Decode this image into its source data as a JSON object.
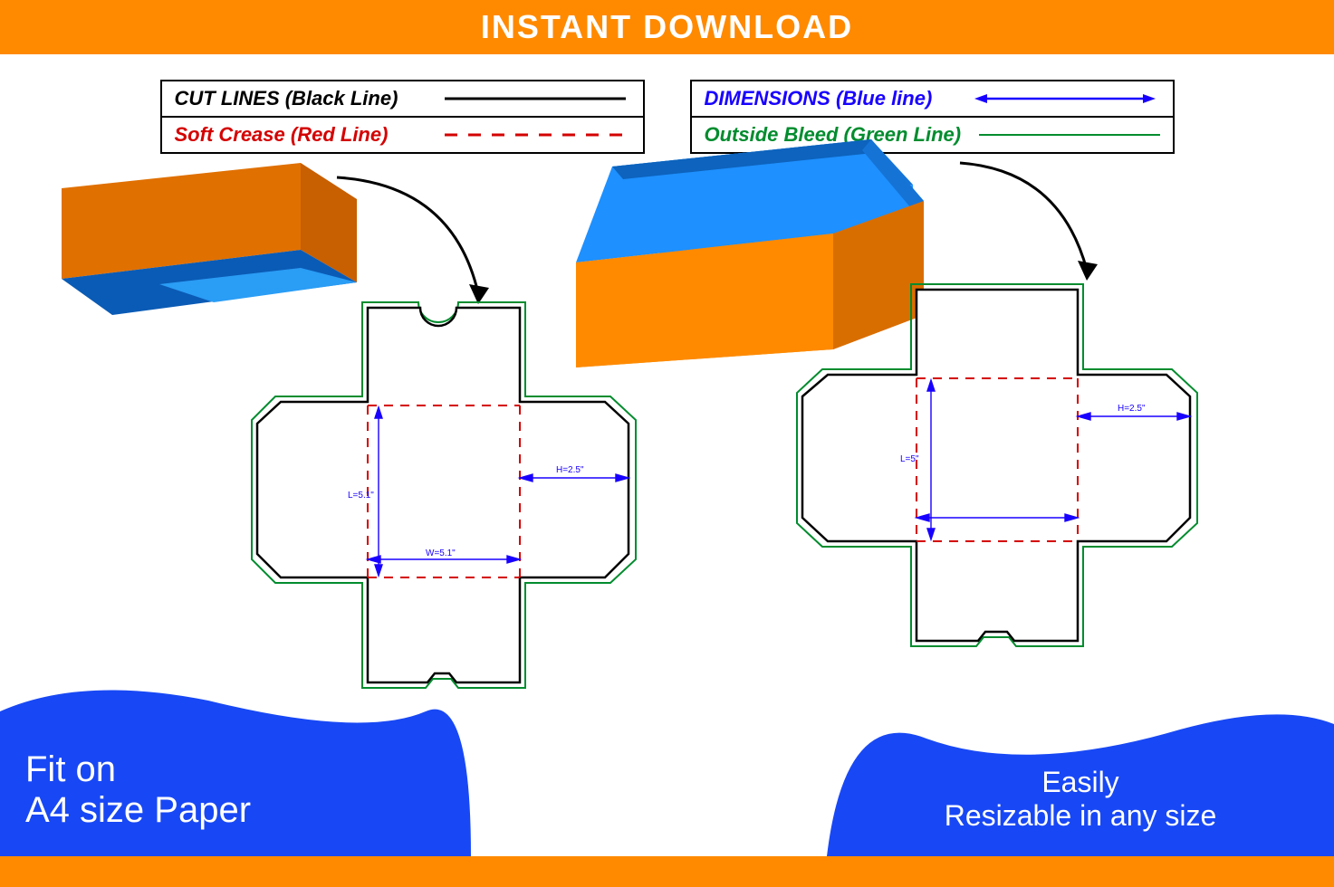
{
  "banner": {
    "title": "INSTANT DOWNLOAD"
  },
  "legend": {
    "left": [
      {
        "label": "CUT LINES (Black Line)",
        "color": "black",
        "style": "solid"
      },
      {
        "label": "Soft Crease (Red Line)",
        "color": "red",
        "style": "dashed"
      }
    ],
    "right": [
      {
        "label": "DIMENSIONS (Blue line)",
        "color": "blue",
        "style": "arrow"
      },
      {
        "label": "Outside Bleed (Green Line)",
        "color": "green",
        "style": "solid-thin"
      }
    ]
  },
  "footer_left": {
    "line1": "Fit on",
    "line2": "A4 size Paper"
  },
  "footer_right": {
    "line1": "Easily",
    "line2": "Resizable in any size"
  },
  "chart_data": [
    {
      "type": "dieline",
      "name": "box-lid",
      "has_thumb_notch": true,
      "dimensions": {
        "length": "L=5.1\"",
        "width": "W=5.1\"",
        "height": "H=2.5\""
      },
      "render_3d": {
        "outer_color": "#ff8a00",
        "inner_color": "#0a7fe0",
        "view": "bottom-open-lid"
      }
    },
    {
      "type": "dieline",
      "name": "box-base",
      "has_thumb_notch": false,
      "dimensions": {
        "length": "L=5\"",
        "width": "",
        "height": "H=2.5\""
      },
      "render_3d": {
        "outer_color": "#ff8a00",
        "inner_color": "#0a7fe0",
        "view": "open-tray"
      }
    }
  ]
}
